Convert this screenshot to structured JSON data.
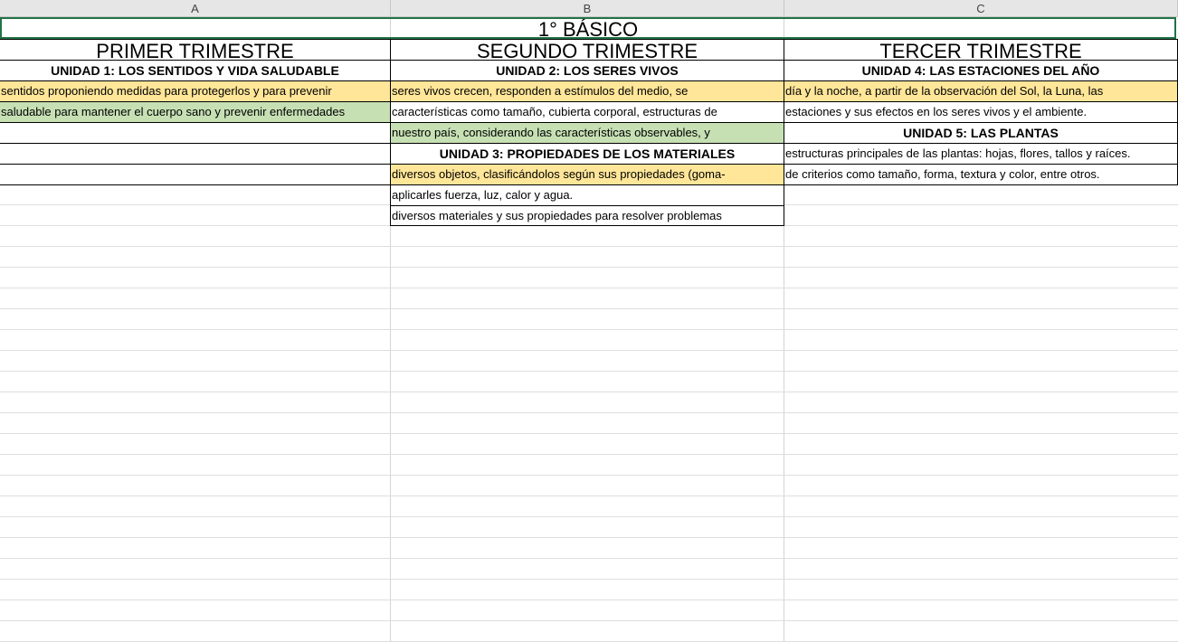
{
  "columns": [
    "A",
    "B",
    "C"
  ],
  "title": "1° BÁSICO",
  "trimesters": [
    "PRIMER TRIMESTRE",
    "SEGUNDO TRIMESTRE",
    "TERCER  TRIMESTRE"
  ],
  "colA": {
    "unit1": "UNIDAD 1: LOS SENTIDOS Y VIDA SALUDABLE",
    "row1": "sentidos proponiendo medidas para protegerlos y para prevenir",
    "row2": "saludable para mantener el cuerpo sano y prevenir enfermedades"
  },
  "colB": {
    "unit2": "UNIDAD 2: LOS SERES VIVOS",
    "row1": "seres vivos crecen, responden a estímulos del medio, se",
    "row2": "características como tamaño, cubierta corporal, estructuras de",
    "row3": "nuestro país, considerando las características observables, y",
    "unit3": "UNIDAD 3: PROPIEDADES DE LOS MATERIALES",
    "row4": "diversos objetos, clasificándolos según sus propiedades (goma-",
    "row5": "aplicarles fuerza, luz, calor y agua.",
    "row6": "diversos materiales y sus propiedades para resolver problemas"
  },
  "colC": {
    "unit4": "UNIDAD 4: LAS ESTACIONES DEL AÑO",
    "row1": "día y la noche, a partir de la observación del Sol, la Luna, las",
    "row2": "estaciones y sus efectos en los seres vivos y el ambiente.",
    "unit5": "UNIDAD 5: LAS PLANTAS",
    "row3": "estructuras principales de las plantas: hojas, flores, tallos y raíces.",
    "row4": "de criterios como tamaño, forma, textura y color, entre otros."
  }
}
